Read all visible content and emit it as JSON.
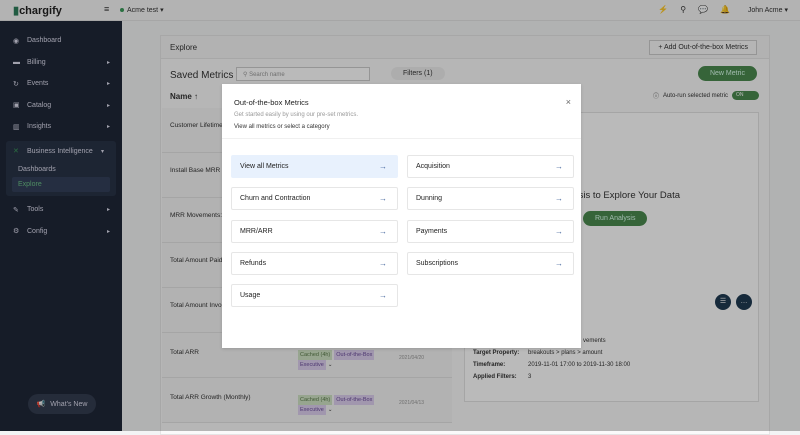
{
  "header": {
    "logo": "chargify",
    "site": "Acme test",
    "user": "John Acme"
  },
  "sidebar": {
    "items": [
      {
        "label": "Dashboard",
        "icon": "dashboard-icon"
      },
      {
        "label": "Billing",
        "icon": "billing-icon"
      },
      {
        "label": "Events",
        "icon": "events-icon"
      },
      {
        "label": "Catalog",
        "icon": "catalog-icon"
      },
      {
        "label": "Insights",
        "icon": "insights-icon"
      }
    ],
    "bi": {
      "label": "Business Intelligence",
      "sub": [
        "Dashboards",
        "Explore"
      ]
    },
    "bottom": [
      {
        "label": "Tools"
      },
      {
        "label": "Config"
      }
    ],
    "whats_new": "What's New"
  },
  "explore": {
    "title": "Explore",
    "add_button": "+ Add Out-of-the-box Metrics",
    "saved_metrics": "Saved Metrics",
    "search_placeholder": "Search name",
    "filters": "Filters (1)",
    "new_metric": "New Metric",
    "auto_run": "Auto-run selected metric",
    "toggle": "ON",
    "name_col": "Name",
    "rows": [
      {
        "name": "Customer Lifetime"
      },
      {
        "name": "Install Base MRR ("
      },
      {
        "name": "MRR Movements: "
      },
      {
        "name": "Total Amount Paid "
      },
      {
        "name": "Total Amount Invoi"
      },
      {
        "name": "Total ARR",
        "tags": [
          "Cached (4h)",
          "Out-of-the-Box",
          "Executive"
        ],
        "date": "2021/04/20"
      },
      {
        "name": "Total ARR Growth (Monthly)",
        "tags": [
          "Cached (4h)",
          "Out-of-the-Box",
          "Executive"
        ],
        "date": "2021/04/13"
      }
    ],
    "panel": {
      "title": "ysis to Explore Your Data",
      "run": "Run Analysis",
      "partial": "vements",
      "target_label": "Target Property:",
      "target": "breakouts > plans > amount",
      "timeframe_label": "Timeframe:",
      "timeframe": "2019-11-01 17:00 to 2019-11-30 18:00",
      "filters_label": "Applied Filters:",
      "filters": "3"
    }
  },
  "modal": {
    "title": "Out-of-the-box Metrics",
    "subtitle": "Get started easily by using our pre-set metrics.",
    "link": "View all metrics or select a category",
    "close": "×",
    "options": [
      "View all Metrics",
      "Acquisition",
      "Churn and Contraction",
      "Dunning",
      "MRR/ARR",
      "Payments",
      "Refunds",
      "Subscriptions",
      "Usage"
    ]
  }
}
